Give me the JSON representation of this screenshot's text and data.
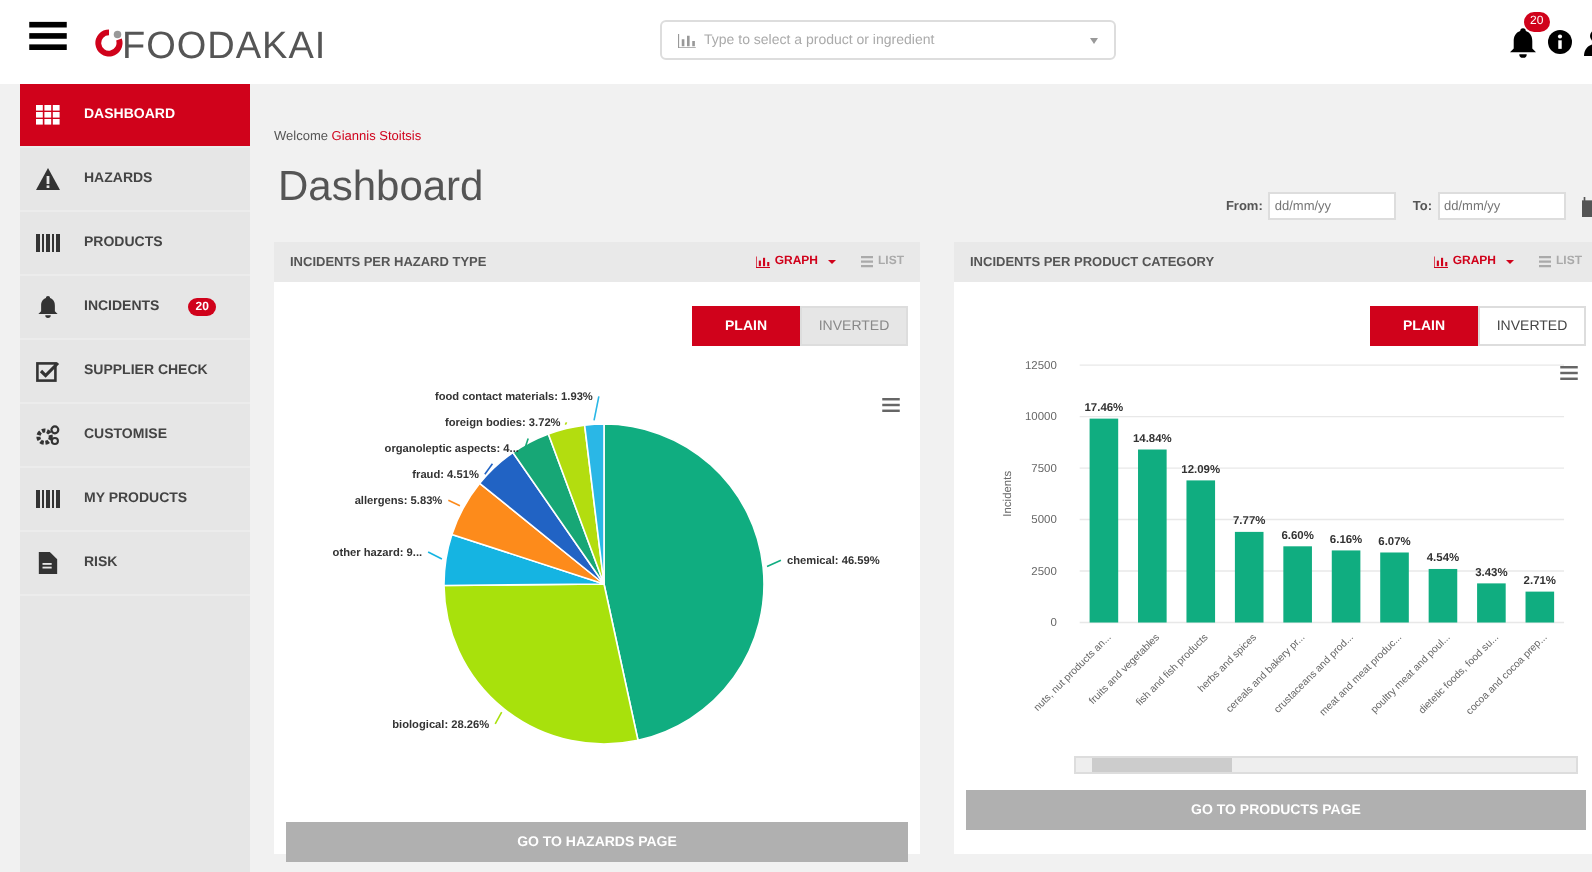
{
  "header": {
    "logo": "FOODAKAI",
    "search": {
      "placeholder": "Type to select a product or ingredient"
    },
    "notifications": {
      "count": "20"
    }
  },
  "sidebar": {
    "items": [
      {
        "label": "DASHBOARD",
        "selected": true
      },
      {
        "label": "HAZARDS",
        "selected": false
      },
      {
        "label": "PRODUCTS",
        "selected": false
      },
      {
        "label": "INCIDENTS",
        "selected": false,
        "badge": "20"
      },
      {
        "label": "SUPPLIER CHECK",
        "selected": false
      },
      {
        "label": "CUSTOMISE",
        "selected": false
      },
      {
        "label": "MY PRODUCTS",
        "selected": false
      },
      {
        "label": "RISK",
        "selected": false
      }
    ]
  },
  "welcome": {
    "prefix": "Welcome",
    "name": "Giannis Stoitsis"
  },
  "title": "Dashboard",
  "date_filter": {
    "from_label": "From:",
    "from_placeholder": "dd/mm/yy",
    "to_label": "To:",
    "to_placeholder": "dd/mm/yy"
  },
  "panels": [
    {
      "title": "INCIDENTS PER HAZARD TYPE",
      "view_tabs": [
        {
          "label": "GRAPH",
          "selected": true
        },
        {
          "label": "LIST",
          "selected": false
        }
      ],
      "modes": [
        {
          "label": "PLAIN",
          "selected": true,
          "disabled": false
        },
        {
          "label": "INVERTED",
          "selected": false,
          "disabled": true
        }
      ],
      "chart_data": {
        "type": "pie",
        "series": [
          {
            "values": [
              46.59,
              28.26,
              5.16,
              5.83,
              4.51,
              4.0,
              3.72,
              1.93
            ]
          }
        ],
        "colors": [
          "#10ad80",
          "#a8e10c",
          "#15b4e2",
          "#fd8b1b",
          "#2163c4",
          "#17a776",
          "#b3dd0f",
          "#2ab7e6"
        ],
        "value_labels": [
          "chemical: 46.59%",
          "biological: 28.26%",
          "other hazard: 9...",
          "allergens: 5.83%",
          "fraud: 4.51%",
          "organoleptic aspects: 4...",
          "foreign bodies: 3.72%",
          "food contact materials: 1.93%"
        ]
      },
      "button": "GO TO HAZARDS PAGE"
    },
    {
      "title": "INCIDENTS PER PRODUCT CATEGORY",
      "view_tabs": [
        {
          "label": "GRAPH",
          "selected": true
        },
        {
          "label": "LIST",
          "selected": false
        }
      ],
      "modes": [
        {
          "label": "PLAIN",
          "selected": true,
          "disabled": false
        },
        {
          "label": "INVERTED",
          "selected": false,
          "disabled": false
        }
      ],
      "chart_data": {
        "type": "bar",
        "ylabel": "Incidents",
        "categories": [
          "nuts, nut products an...",
          "fruits and vegetables",
          "fish and fish products",
          "herbs and spices",
          "cereals and bakery pr...",
          "crustaceans and prod...",
          "meat and meat produc...",
          "poultry meat and poul...",
          "dietetic foods, food su...",
          "cocoa and cocoa prep..."
        ],
        "series": [
          {
            "color": "#10ad80",
            "values": [
              9900,
              8400,
              6900,
              4400,
              3700,
              3500,
              3400,
              2600,
              1900,
              1500
            ]
          }
        ],
        "ylim": [
          0,
          12500
        ],
        "grid": true,
        "yticks": [
          0,
          2500,
          5000,
          7500,
          10000,
          12500
        ],
        "value_labels": [
          "17.46%",
          "14.84%",
          "12.09%",
          "7.77%",
          "6.60%",
          "6.16%",
          "6.07%",
          "4.54%",
          "3.43%",
          "2.71%"
        ]
      },
      "button": "GO TO PRODUCTS PAGE"
    }
  ]
}
